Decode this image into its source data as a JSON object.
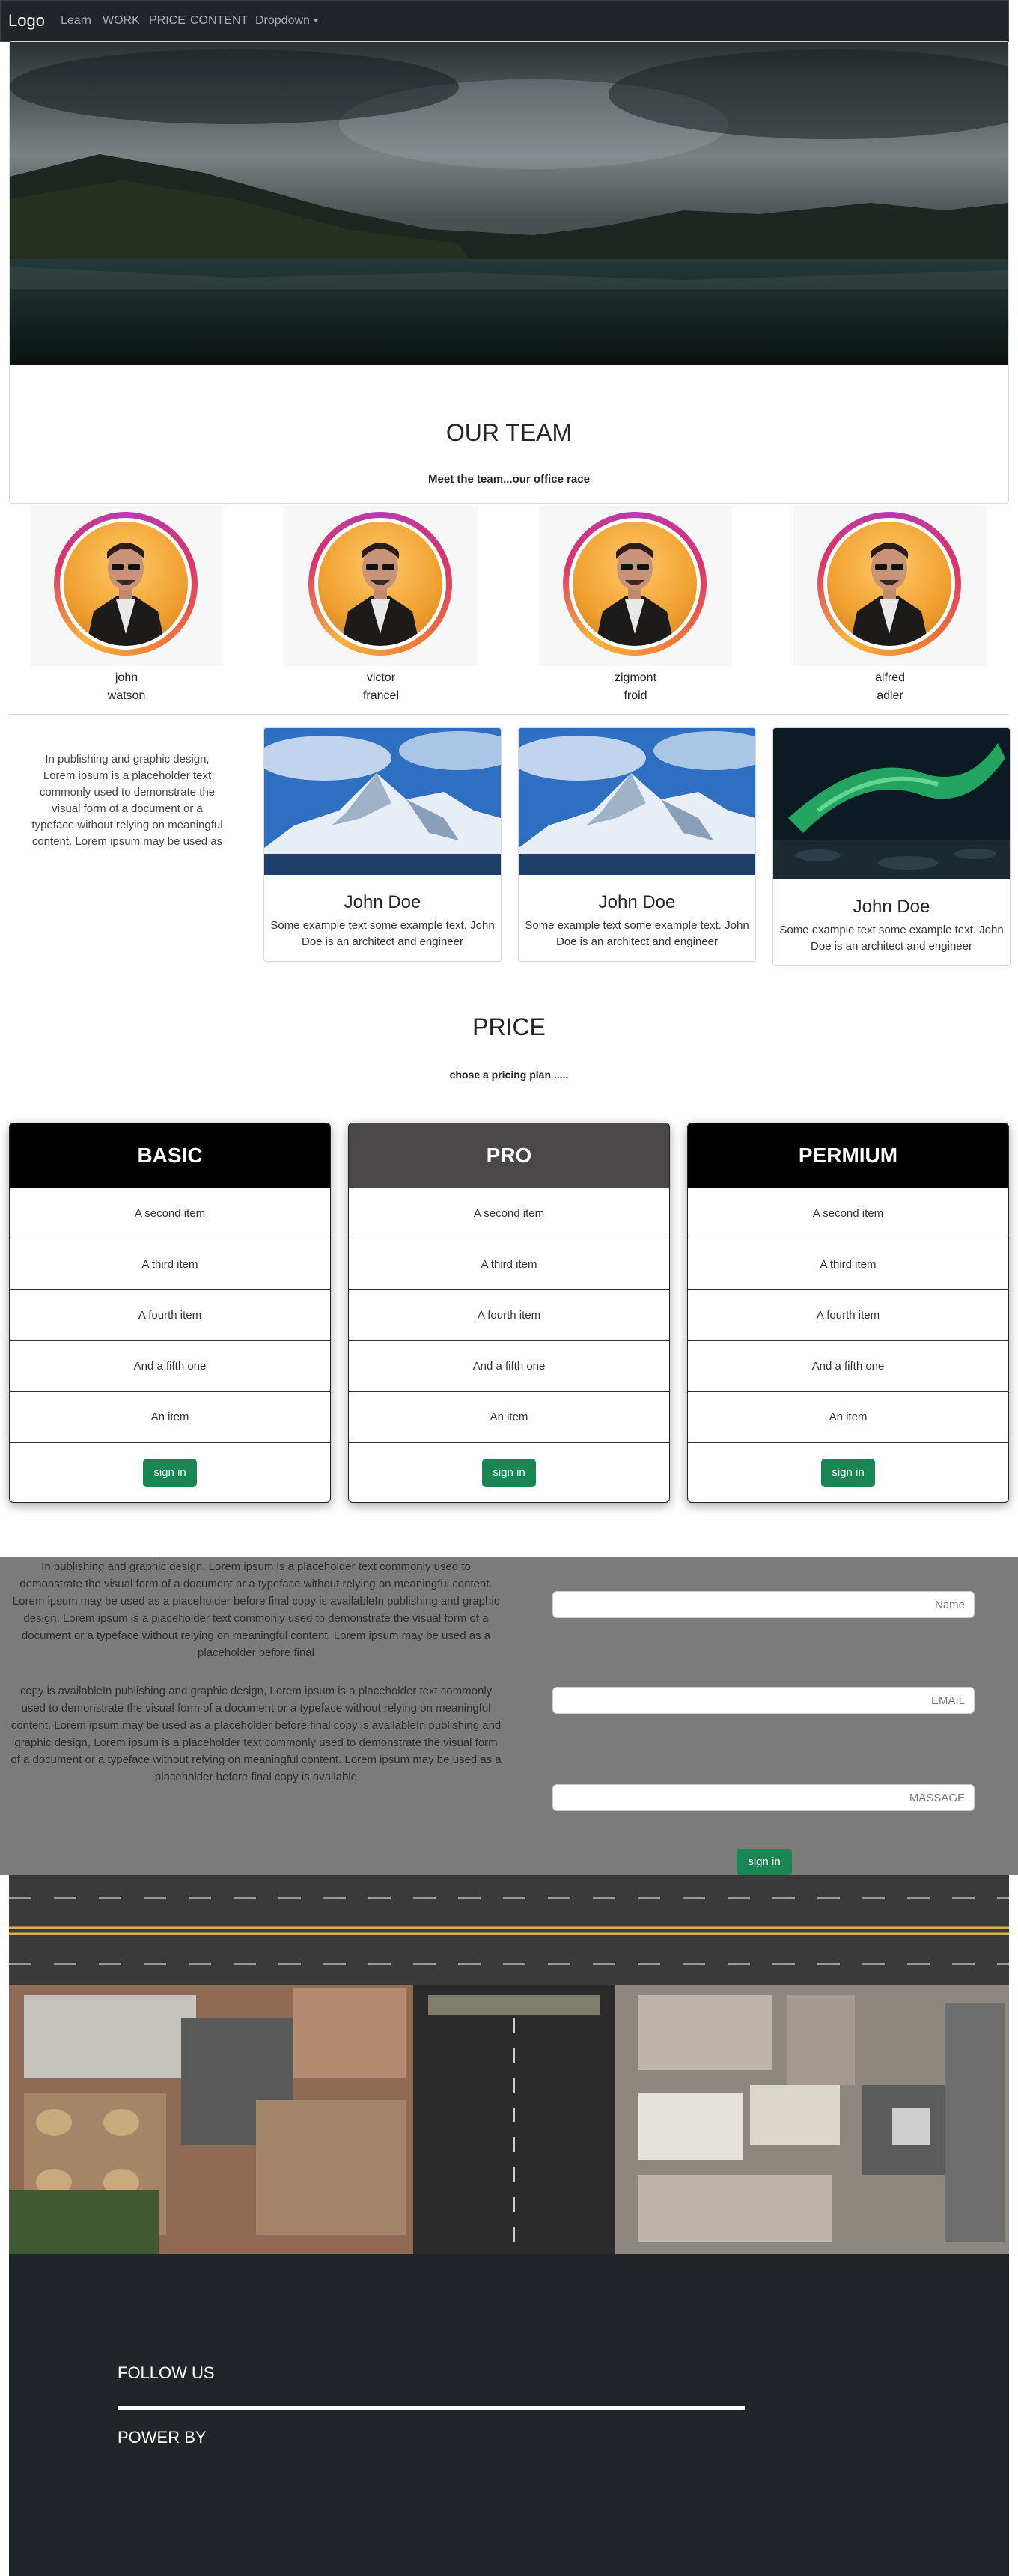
{
  "nav": {
    "logo": "Logo",
    "items": [
      "Learn",
      "WORK",
      "PRICE",
      "CONTENT",
      "Dropdown"
    ]
  },
  "hero": {
    "title": "OUR TEAM",
    "subtitle": "Meet the team...our office race"
  },
  "team": [
    {
      "first": "john",
      "last": "watson"
    },
    {
      "first": "victor",
      "last": "francel"
    },
    {
      "first": "zigmont",
      "last": "froid"
    },
    {
      "first": "alfred",
      "last": "adler"
    }
  ],
  "intro": {
    "text": "In publishing and graphic design, Lorem ipsum is a placeholder text commonly used to demonstrate the visual form of a document or a typeface without relying on meaningful content. Lorem ipsum may be used as"
  },
  "cards": [
    {
      "title": "John Doe",
      "text": "Some example text some example text. John Doe is an architect and engineer",
      "image": "snowy-mountain"
    },
    {
      "title": "John Doe",
      "text": "Some example text some example text. John Doe is an architect and engineer",
      "image": "snowy-mountain"
    },
    {
      "title": "John Doe",
      "text": "Some example text some example text. John Doe is an architect and engineer",
      "image": "aurora"
    }
  ],
  "price": {
    "title": "PRICE",
    "subtitle": "chose a pricing plan .....",
    "plans": [
      {
        "name": "BASIC",
        "items": [
          "A second item",
          "A third item",
          "A fourth item",
          "And a fifth one",
          "An item"
        ],
        "button": "sign in"
      },
      {
        "name": "PRO",
        "items": [
          "A second item",
          "A third item",
          "A fourth item",
          "And a fifth one",
          "An item"
        ],
        "button": "sign in"
      },
      {
        "name": "PERMIUM",
        "items": [
          "A second item",
          "A third item",
          "A fourth item",
          "And a fifth one",
          "An item"
        ],
        "button": "sign in"
      }
    ]
  },
  "contact": {
    "paragraph1": "In publishing and graphic design, Lorem ipsum is a placeholder text commonly used to demonstrate the visual form of a document or a typeface without relying on meaningful content. Lorem ipsum may be used as a placeholder before final copy is availableIn publishing and graphic design, Lorem ipsum is a placeholder text commonly used to demonstrate the visual form of a document or a typeface without relying on meaningful content. Lorem ipsum may be used as a placeholder before final",
    "paragraph2": "copy is availableIn publishing and graphic design, Lorem ipsum is a placeholder text commonly used to demonstrate the visual form of a document or a typeface without relying on meaningful content. Lorem ipsum may be used as a placeholder before final copy is availableIn publishing and graphic design, Lorem ipsum is a placeholder text commonly used to demonstrate the visual form of a document or a typeface without relying on meaningful content. Lorem ipsum may be used as a placeholder before final copy is available",
    "name_placeholder": "Name",
    "email_placeholder": "EMAIL",
    "message_placeholder": "MASSAGE",
    "button": "sign in"
  },
  "footer": {
    "follow": "FOLLOW US",
    "power": "POWER BY"
  },
  "colors": {
    "navbar": "#212529",
    "accent_green": "#198754",
    "contact_bg": "#7b7b7b",
    "footer": "#212529"
  }
}
